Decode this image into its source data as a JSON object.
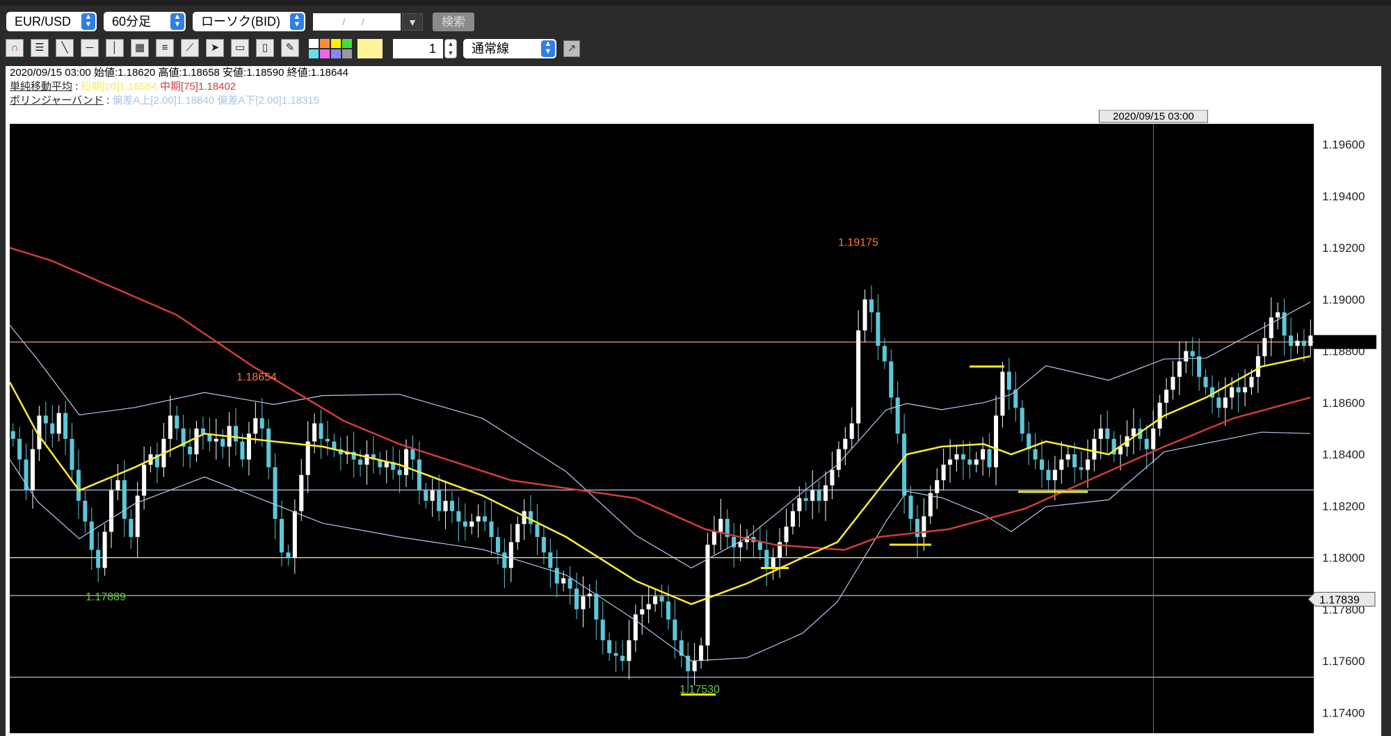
{
  "toolbar": {
    "symbol": "EUR/USD",
    "timeframe": "60分足",
    "chart_type": "ローソク(BID)",
    "date_placeholder": "/ /",
    "search_label": "検索",
    "quantity": "1",
    "line_type": "通常線",
    "tools": [
      "magnet-icon",
      "horizontal-lines-icon",
      "trend-line-icon",
      "horizontal-line-icon",
      "vertical-line-icon",
      "grid-icon",
      "fibonacci-icon",
      "fan-icon",
      "cursor-icon",
      "eraser-icon",
      "trash-icon",
      "pencil-icon"
    ],
    "palette": [
      "#ffffff",
      "#ff8c3c",
      "#ffee00",
      "#44dd44",
      "#66ddee",
      "#ee66ee",
      "#8888ff",
      "#999999"
    ],
    "selected_color": "#fff399"
  },
  "info": {
    "ohlc": "2020/09/15 03:00 始値:1.18620 高値:1.18658 安値:1.18590 終値:1.18644",
    "sma_label": "単純移動平均",
    "sma_colon": ":",
    "sma_short": "短期[20]1.18584",
    "sma_mid": "中期[75]1.18402",
    "bb_label": "ボリンジャーバンド",
    "bb_colon": ":",
    "bb_upper": "偏差A上[2.00]1.18840",
    "bb_lower": "偏差A下[2.00]1.18315"
  },
  "colors": {
    "sma_short": "#ffee33",
    "sma_mid": "#d23c3c",
    "bb": "#b8c8f0",
    "price_line": "#e8a070",
    "bull": "#ffffff",
    "bear": "#5cc8d8",
    "annotation": "#ffee00",
    "high_label": "#ff7a2a",
    "low_label": "#66cc33"
  },
  "chart_data": {
    "type": "candlestick",
    "yrange": [
      1.1732,
      1.1968
    ],
    "yticks": [
      "1.19600",
      "1.19400",
      "1.19200",
      "1.19000",
      "1.18800",
      "1.18600",
      "1.18400",
      "1.18200",
      "1.18000",
      "1.17800",
      "1.17600",
      "1.17400"
    ],
    "crosshair_time": "2020/09/15 03:00",
    "current_price_label": "1.17839",
    "current_price": 1.17839,
    "price_line": 1.18835,
    "hlines": [
      {
        "y": 1.18262,
        "color": "#b8c8f0"
      },
      {
        "y": 1.18,
        "color": "#f0f0a0"
      },
      {
        "y": 1.17853,
        "color": "#bbbbbb"
      },
      {
        "y": 1.17537,
        "color": "#b8c8f0"
      }
    ],
    "annotations": [
      {
        "text": "1.19175",
        "y": 1.19175,
        "type": "high"
      },
      {
        "text": "1.18654",
        "y": 1.18654,
        "type": "high"
      },
      {
        "text": "1.17889",
        "y": 1.17889,
        "type": "low"
      },
      {
        "text": "1.17530",
        "y": 1.1753,
        "type": "low"
      }
    ],
    "closes": [
      1.1846,
      1.1838,
      1.1826,
      1.1842,
      1.1855,
      1.1852,
      1.1848,
      1.1856,
      1.1846,
      1.1834,
      1.1822,
      1.1814,
      1.1803,
      1.1796,
      1.181,
      1.1826,
      1.183,
      1.1815,
      1.1808,
      1.1824,
      1.1836,
      1.184,
      1.1835,
      1.1846,
      1.1855,
      1.185,
      1.1843,
      1.184,
      1.185,
      1.1848,
      1.1845,
      1.1846,
      1.1843,
      1.1851,
      1.1845,
      1.1838,
      1.1848,
      1.1854,
      1.185,
      1.1835,
      1.1815,
      1.1802,
      1.18,
      1.1818,
      1.1832,
      1.1845,
      1.1852,
      1.1846,
      1.1845,
      1.1842,
      1.184,
      1.1841,
      1.1838,
      1.1836,
      1.184,
      1.1838,
      1.1835,
      1.1837,
      1.1834,
      1.1832,
      1.1842,
      1.1838,
      1.1826,
      1.1822,
      1.1826,
      1.1818,
      1.1822,
      1.1818,
      1.1814,
      1.1812,
      1.1814,
      1.1816,
      1.1814,
      1.1808,
      1.1802,
      1.1796,
      1.1806,
      1.1813,
      1.1818,
      1.1813,
      1.1808,
      1.1802,
      1.1796,
      1.179,
      1.1792,
      1.1788,
      1.178,
      1.1785,
      1.1786,
      1.1776,
      1.1768,
      1.1763,
      1.1762,
      1.176,
      1.1768,
      1.1778,
      1.178,
      1.1782,
      1.1785,
      1.1783,
      1.1776,
      1.1768,
      1.1762,
      1.1756,
      1.176,
      1.1766,
      1.1805,
      1.181,
      1.1815,
      1.1808,
      1.1804,
      1.1806,
      1.1808,
      1.1806,
      1.1803,
      1.1796,
      1.18,
      1.1806,
      1.1812,
      1.1818,
      1.1823,
      1.1822,
      1.1826,
      1.1822,
      1.1828,
      1.1834,
      1.1842,
      1.1846,
      1.1852,
      1.1888,
      1.19,
      1.1895,
      1.1882,
      1.1876,
      1.1862,
      1.1848,
      1.1824,
      1.1815,
      1.1808,
      1.1816,
      1.1825,
      1.183,
      1.1836,
      1.1838,
      1.184,
      1.1838,
      1.1836,
      1.1838,
      1.1842,
      1.1835,
      1.1855,
      1.1872,
      1.1865,
      1.1858,
      1.1848,
      1.1842,
      1.1838,
      1.1834,
      1.183,
      1.1834,
      1.1838,
      1.184,
      1.1835,
      1.1834,
      1.1838,
      1.1846,
      1.185,
      1.1846,
      1.184,
      1.1843,
      1.1847,
      1.185,
      1.1846,
      1.1842,
      1.185,
      1.186,
      1.1865,
      1.187,
      1.1876,
      1.188,
      1.1878,
      1.187,
      1.1866,
      1.1862,
      1.1858,
      1.1862,
      1.1866,
      1.1864,
      1.1866,
      1.187,
      1.1878,
      1.1885,
      1.1893,
      1.1895,
      1.1886,
      1.1882,
      1.1884,
      1.1882,
      1.1886
    ],
    "sma20": [
      [
        0,
        1.1868
      ],
      [
        40,
        1.1848
      ],
      [
        100,
        1.1826
      ],
      [
        180,
        1.1835
      ],
      [
        280,
        1.1848
      ],
      [
        380,
        1.1845
      ],
      [
        450,
        1.1843
      ],
      [
        560,
        1.1836
      ],
      [
        680,
        1.1824
      ],
      [
        800,
        1.1808
      ],
      [
        900,
        1.1791
      ],
      [
        980,
        1.1782
      ],
      [
        1060,
        1.179
      ],
      [
        1140,
        1.18
      ],
      [
        1190,
        1.1806
      ],
      [
        1260,
        1.183
      ],
      [
        1290,
        1.184
      ],
      [
        1340,
        1.1843
      ],
      [
        1400,
        1.1844
      ],
      [
        1440,
        1.184
      ],
      [
        1490,
        1.1845
      ],
      [
        1580,
        1.184
      ],
      [
        1660,
        1.1855
      ],
      [
        1720,
        1.1862
      ],
      [
        1800,
        1.1874
      ],
      [
        1870,
        1.1878
      ]
    ],
    "sma75": [
      [
        0,
        1.192
      ],
      [
        60,
        1.1915
      ],
      [
        120,
        1.1908
      ],
      [
        240,
        1.1894
      ],
      [
        350,
        1.1874
      ],
      [
        480,
        1.1853
      ],
      [
        560,
        1.1844
      ],
      [
        720,
        1.183
      ],
      [
        900,
        1.1823
      ],
      [
        1000,
        1.1811
      ],
      [
        1100,
        1.1805
      ],
      [
        1200,
        1.1803
      ],
      [
        1250,
        1.1808
      ],
      [
        1350,
        1.1811
      ],
      [
        1460,
        1.1819
      ],
      [
        1560,
        1.1831
      ],
      [
        1660,
        1.1843
      ],
      [
        1760,
        1.1854
      ],
      [
        1870,
        1.1862
      ]
    ]
  }
}
